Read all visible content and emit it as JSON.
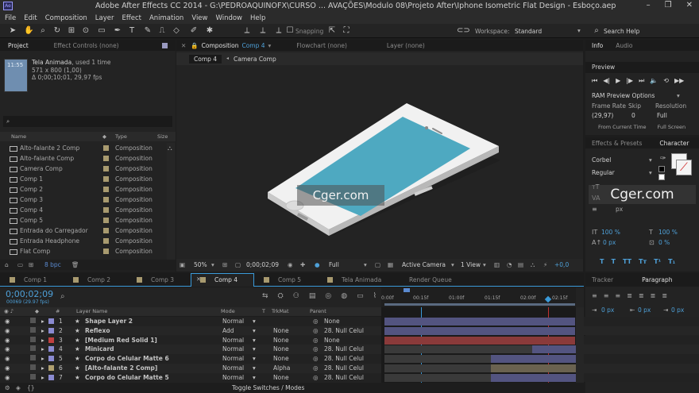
{
  "app": {
    "title": "Adobe After Effects CC 2014 - G:\\PEDROAQUINOFX\\CURSO ... AVAÇÕES\\Modulo 08\\Projeto After\\Iphone Isometric Flat Design - Esboço.aep"
  },
  "menu": [
    "File",
    "Edit",
    "Composition",
    "Layer",
    "Effect",
    "Animation",
    "View",
    "Window",
    "Help"
  ],
  "toolbar": {
    "snapping": "Snapping",
    "workspace_label": "Workspace:",
    "workspace_value": "Standard",
    "search_placeholder": "Search Help"
  },
  "project": {
    "tab": "Project",
    "tab2": "Effect Controls (none)",
    "thumb_name": "Tela Animada",
    "thumb_used": ", used 1 time",
    "thumb_size": "571 x 800 (1,00)",
    "thumb_dur": "Δ 0;00;10;01, 29,97 fps",
    "thumb_label": "11:55",
    "col_name": "Name",
    "col_type": "Type",
    "col_size": "Size",
    "items": [
      {
        "name": "Alto-falante 2 Comp",
        "type": "Composition"
      },
      {
        "name": "Alto-falante Comp",
        "type": "Composition"
      },
      {
        "name": "Camera Comp",
        "type": "Composition"
      },
      {
        "name": "Comp 1",
        "type": "Composition"
      },
      {
        "name": "Comp 2",
        "type": "Composition"
      },
      {
        "name": "Comp 3",
        "type": "Composition"
      },
      {
        "name": "Comp 4",
        "type": "Composition"
      },
      {
        "name": "Comp 5",
        "type": "Composition"
      },
      {
        "name": "Entrada do Carregador",
        "type": "Composition"
      },
      {
        "name": "Entrada Headphone",
        "type": "Composition"
      },
      {
        "name": "Flat Comp",
        "type": "Composition"
      }
    ],
    "bpc": "8 bpc"
  },
  "comp": {
    "tab": "Composition",
    "tab_name": "Comp 4",
    "flowchart": "Flowchart (none)",
    "layer_tab": "Layer (none)",
    "crumbs": [
      "Comp 4",
      "Camera Comp"
    ],
    "zoom": "50%",
    "time": "0;00;02;09",
    "res": "Full",
    "camera": "Active Camera",
    "view": "1 View",
    "exposure": "+0,0",
    "watermark": "Cger.com"
  },
  "info": {
    "tabs": [
      "Info",
      "Audio"
    ],
    "preview": "Preview",
    "ram": "RAM Preview Options",
    "fr_label": "Frame Rate",
    "skip_label": "Skip",
    "res_label": "Resolution",
    "fr": "(29,97)",
    "skip": "0",
    "res": "Full",
    "from": "From Current Time",
    "full": "Full Screen"
  },
  "character": {
    "tabs": [
      "Effects & Presets",
      "Character"
    ],
    "font": "Corbel",
    "style": "Regular",
    "unit": "px",
    "scale_v": "100 %",
    "scale_h": "100 %",
    "baseline": "0 px",
    "tsume": "0 %",
    "watermark": "Cger.com"
  },
  "paragraph": {
    "tabs": [
      "Tracker",
      "Paragraph"
    ],
    "val": "0 px"
  },
  "timeline": {
    "tabs": [
      "Comp 1",
      "Comp 2",
      "Comp 3",
      "Comp 4",
      "Comp 5",
      "Tela Animada",
      "Render Queue"
    ],
    "timecode": "0;00;02;09",
    "frames": "00069 (29.97 fps)",
    "col_layer": "Layer Name",
    "col_mode": "Mode",
    "col_t": "T",
    "col_trk": "TrkMat",
    "col_parent": "Parent",
    "ticks": [
      "0:00f",
      "00:15f",
      "01:00f",
      "01:15f",
      "02:00f",
      "02:15f"
    ],
    "layers": [
      {
        "num": "1",
        "name": "Shape Layer 2",
        "mode": "Normal",
        "trk": "",
        "parent": "None",
        "color": "#8a8ad0"
      },
      {
        "num": "2",
        "name": "Reflexo",
        "mode": "Add",
        "trk": "None",
        "parent": "28. Null Celul",
        "color": "#8a8ad0"
      },
      {
        "num": "3",
        "name": "[Medium Red Solid 1]",
        "mode": "Normal",
        "trk": "None",
        "parent": "None",
        "color": "#c04040"
      },
      {
        "num": "4",
        "name": "Minicard",
        "mode": "Normal",
        "trk": "None",
        "parent": "28. Null Celul",
        "color": "#8a8ad0"
      },
      {
        "num": "5",
        "name": "Corpo do Celular Matte 6",
        "mode": "Normal",
        "trk": "None",
        "parent": "28. Null Celul",
        "color": "#8a8ad0"
      },
      {
        "num": "6",
        "name": "[Alto-falante 2 Comp]",
        "mode": "Normal",
        "trk": "Alpha",
        "parent": "28. Null Celul",
        "color": "#b0a070"
      },
      {
        "num": "7",
        "name": "Corpo do Celular Matte 5",
        "mode": "Normal",
        "trk": "None",
        "parent": "28. Null Celul",
        "color": "#8a8ad0"
      }
    ],
    "toggle": "Toggle Switches / Modes"
  },
  "colors": {
    "accent": "#3a9ad9",
    "screen": "#4ea9c1",
    "bg": "#1d1d1d"
  }
}
